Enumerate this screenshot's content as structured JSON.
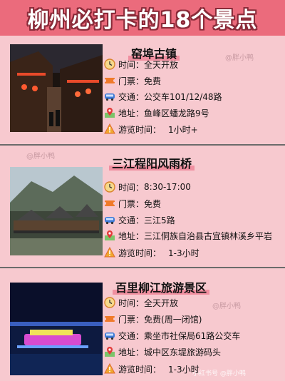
{
  "title": "柳州必打卡的18个景点",
  "watermark": "@胖小鸭",
  "footer_watermark": "小红书号 @胖小鸭",
  "spots": [
    {
      "name": "窑埠古镇",
      "rows": [
        {
          "icon": "clock-icon",
          "label": "时间：",
          "value": "全天开放"
        },
        {
          "icon": "ticket-icon",
          "label": "门票：",
          "value": "免费"
        },
        {
          "icon": "bus-icon",
          "label": "交通：",
          "value": "公交车101/12/48路"
        },
        {
          "icon": "map-pin-icon",
          "label": "地址：",
          "value": "鱼峰区蟠龙路9号"
        },
        {
          "icon": "warning-icon",
          "label": "游览时间：",
          "value": "1小时+"
        }
      ]
    },
    {
      "name": "三江程阳风雨桥",
      "rows": [
        {
          "icon": "clock-icon",
          "label": "时间：",
          "value": "8:30-17:00"
        },
        {
          "icon": "ticket-icon",
          "label": "门票：",
          "value": "免费"
        },
        {
          "icon": "bus-icon",
          "label": "交通：",
          "value": "三江5路"
        },
        {
          "icon": "map-pin-icon",
          "label": "地址：",
          "value": "三江侗族自治县古宜镇林溪乡平岩"
        },
        {
          "icon": "warning-icon",
          "label": "游览时间：",
          "value": "1-3小时"
        }
      ]
    },
    {
      "name": "百里柳江旅游景区",
      "rows": [
        {
          "icon": "clock-icon",
          "label": "时间：",
          "value": "全天开放"
        },
        {
          "icon": "ticket-icon",
          "label": "门票：",
          "value": "免费(周一闭馆)"
        },
        {
          "icon": "bus-icon",
          "label": "交通：",
          "value": "乘坐市社保局61路公交车"
        },
        {
          "icon": "map-pin-icon",
          "label": "地址：",
          "value": "城中区东堤旅游码头"
        },
        {
          "icon": "warning-icon",
          "label": "游览时间：",
          "value": "1-3小时"
        }
      ]
    }
  ],
  "colors": {
    "background": "#f7c9cf",
    "title_bar": "#eb6b7c",
    "highlight": "#f08fa0"
  }
}
